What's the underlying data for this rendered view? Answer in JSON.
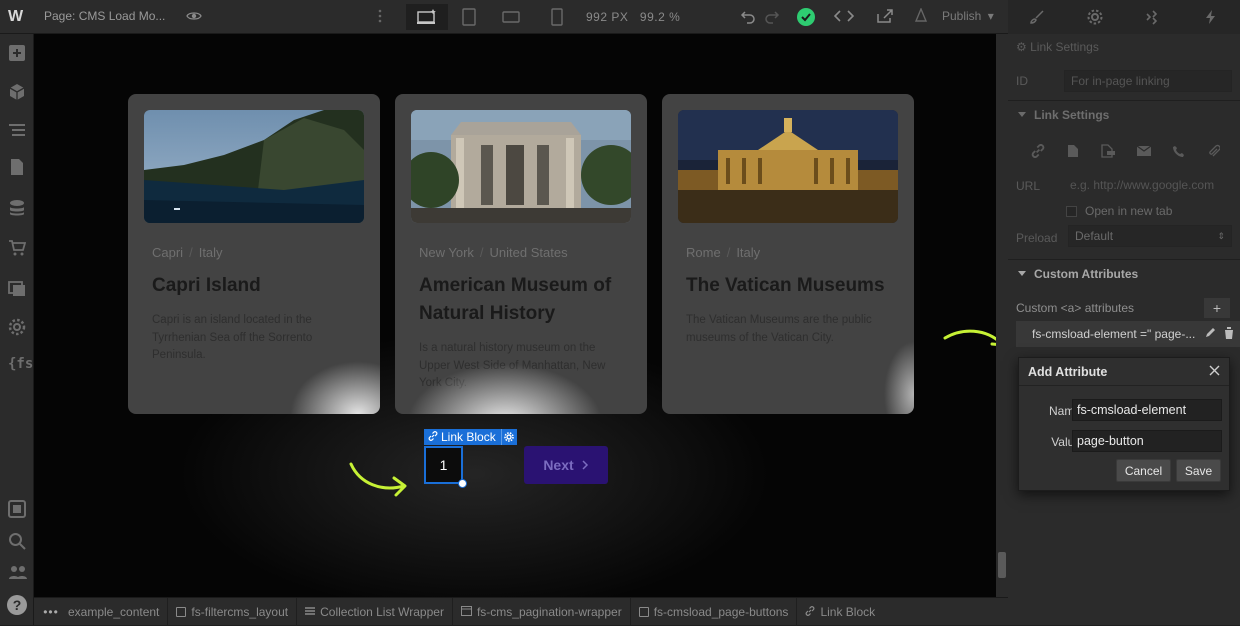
{
  "topbar": {
    "logo": "W",
    "page_label": "Page: CMS Load Mo...",
    "width_px": "992 PX",
    "zoom": "99.2 %",
    "publish_label": "Publish"
  },
  "canvas": {
    "cards": [
      {
        "city": "Capri",
        "country": "Italy",
        "title": "Capri Island",
        "description": "Capri is an island located in the Tyrrhenian Sea off the Sorrento Peninsula."
      },
      {
        "city": "New York",
        "country": "United States",
        "title": "American Museum of Natural History",
        "description": "Is a natural history museum on the Upper West Side of Manhattan, New York City."
      },
      {
        "city": "Rome",
        "country": "Italy",
        "title": "The Vatican Museums",
        "description": "The Vatican Museums are the public museums of the Vatican City."
      }
    ],
    "selection_tag": "Link Block",
    "page_button": "1",
    "next_button": "Next"
  },
  "breadcrumbs": [
    "example_content",
    "fs-filtercms_layout",
    "Collection List Wrapper",
    "fs-cms_pagination-wrapper",
    "fs-cmsload_page-buttons",
    "Link Block"
  ],
  "right_panel": {
    "link_settings_top": "Link Settings",
    "id_label": "ID",
    "id_placeholder": "For in-page linking",
    "link_settings": "Link Settings",
    "url_label": "URL",
    "url_placeholder": "e.g. http://www.google.com",
    "open_new_tab": "Open in new tab",
    "preload_label": "Preload",
    "preload_value": "Default",
    "custom_attributes": "Custom Attributes",
    "custom_a_label": "Custom <a> attributes",
    "attribute_row": "fs-cmsload-element =\" page-..."
  },
  "dialog": {
    "title": "Add Attribute",
    "name_label": "Name",
    "name_value": "fs-cmsload-element",
    "value_label": "Value",
    "value_value": "page-button",
    "cancel": "Cancel",
    "save": "Save"
  },
  "colors": {
    "accent": "#1a6fd8",
    "next_button_bg": "#2a1272",
    "arrow_annotation": "#c6f135",
    "success": "#2ecc71"
  }
}
